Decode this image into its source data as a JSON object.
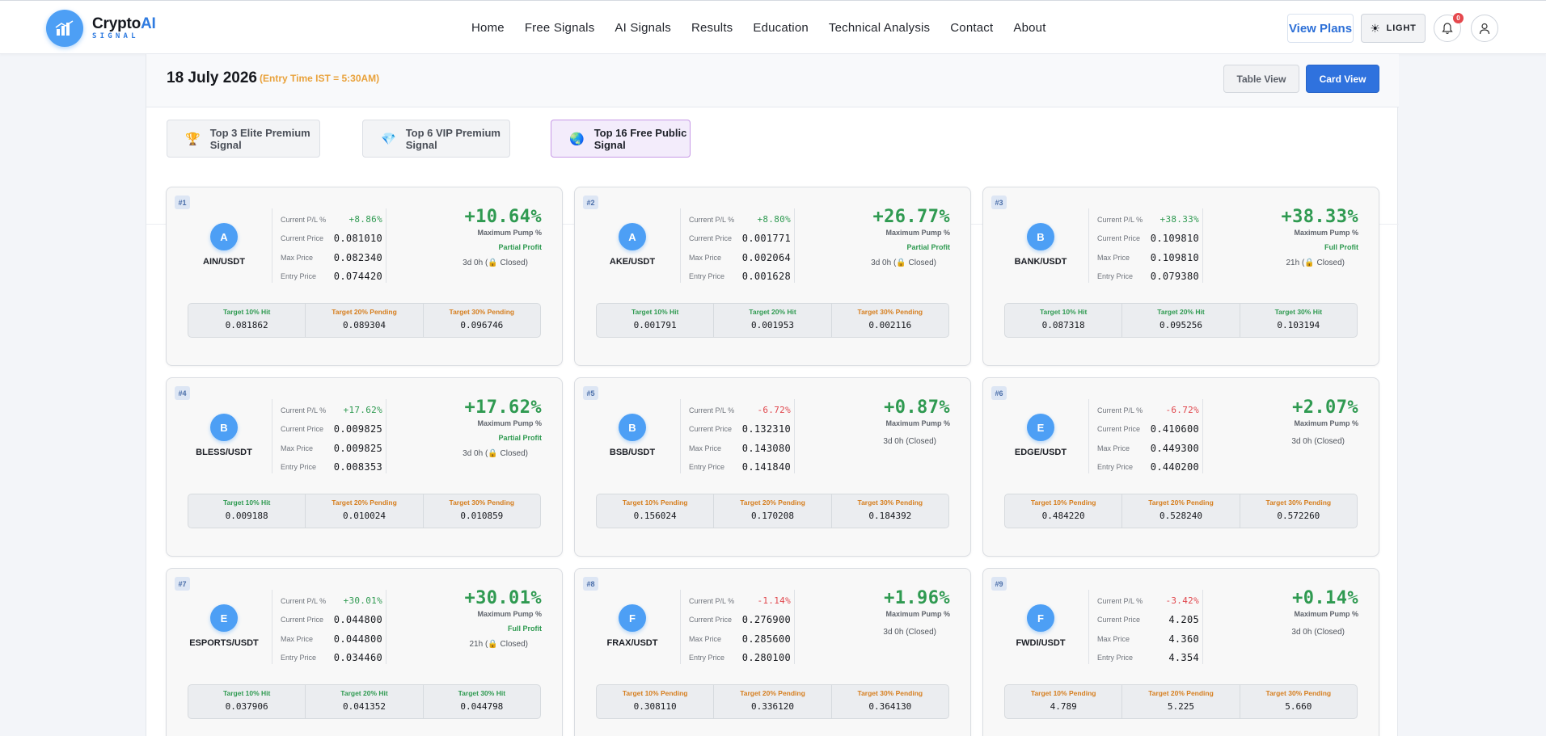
{
  "brand": {
    "name_main": "Crypto",
    "name_accent": "AI",
    "sub": "SIGNAL"
  },
  "nav": [
    "Home",
    "Free Signals",
    "AI Signals",
    "Results",
    "Education",
    "Technical Analysis",
    "Contact",
    "About"
  ],
  "header": {
    "view_plans": "View Plans",
    "theme_label": "LIGHT",
    "notification_count": "0"
  },
  "date_bar": {
    "date": "18 July 2026",
    "entry_time": "(Entry Time IST = 5:30AM)",
    "table_view": "Table View",
    "card_view": "Card View"
  },
  "tabs": [
    {
      "icon": "🏆",
      "label": "Top 3 Elite Premium Signal"
    },
    {
      "icon": "💎",
      "label": "Top 6 VIP Premium Signal"
    },
    {
      "icon": "🌏",
      "label": "Top 16 Free Public Signal"
    }
  ],
  "labels": {
    "pl": "Current P/L %",
    "current": "Current Price",
    "max": "Max Price",
    "entry": "Entry Price",
    "pump": "Maximum Pump %"
  },
  "colors": {
    "accent": "#2f72de",
    "positive": "#2f9a51",
    "negative": "#e0464c",
    "pending": "#d67e1e"
  },
  "cards": [
    {
      "num": "#1",
      "letter": "A",
      "pair": "AIN/USDT",
      "pl": "+8.86%",
      "pl_type": "pos",
      "current": "0.081010",
      "max": "0.082340",
      "entry": "0.074420",
      "pump": "+10.64%",
      "status": "Partial Profit",
      "time_prefix": "3d 0h (",
      "time_suffix": " Closed)",
      "lock": true,
      "targets": [
        {
          "label": "Target 10% Hit",
          "type": "hit",
          "value": "0.081862"
        },
        {
          "label": "Target 20% Pending",
          "type": "pending",
          "value": "0.089304"
        },
        {
          "label": "Target 30% Pending",
          "type": "pending",
          "value": "0.096746"
        }
      ]
    },
    {
      "num": "#2",
      "letter": "A",
      "pair": "AKE/USDT",
      "pl": "+8.80%",
      "pl_type": "pos",
      "current": "0.001771",
      "max": "0.002064",
      "entry": "0.001628",
      "pump": "+26.77%",
      "status": "Partial Profit",
      "time_prefix": "3d 0h (",
      "time_suffix": " Closed)",
      "lock": true,
      "targets": [
        {
          "label": "Target 10% Hit",
          "type": "hit",
          "value": "0.001791"
        },
        {
          "label": "Target 20% Hit",
          "type": "hit",
          "value": "0.001953"
        },
        {
          "label": "Target 30% Pending",
          "type": "pending",
          "value": "0.002116"
        }
      ]
    },
    {
      "num": "#3",
      "letter": "B",
      "pair": "BANK/USDT",
      "pl": "+38.33%",
      "pl_type": "pos",
      "current": "0.109810",
      "max": "0.109810",
      "entry": "0.079380",
      "pump": "+38.33%",
      "status": "Full Profit",
      "time_prefix": "21h (",
      "time_suffix": " Closed)",
      "lock": true,
      "targets": [
        {
          "label": "Target 10% Hit",
          "type": "hit",
          "value": "0.087318"
        },
        {
          "label": "Target 20% Hit",
          "type": "hit",
          "value": "0.095256"
        },
        {
          "label": "Target 30% Hit",
          "type": "hit",
          "value": "0.103194"
        }
      ]
    },
    {
      "num": "#4",
      "letter": "B",
      "pair": "BLESS/USDT",
      "pl": "+17.62%",
      "pl_type": "pos",
      "current": "0.009825",
      "max": "0.009825",
      "entry": "0.008353",
      "pump": "+17.62%",
      "status": "Partial Profit",
      "time_prefix": "3d 0h (",
      "time_suffix": " Closed)",
      "lock": true,
      "targets": [
        {
          "label": "Target 10% Hit",
          "type": "hit",
          "value": "0.009188"
        },
        {
          "label": "Target 20% Pending",
          "type": "pending",
          "value": "0.010024"
        },
        {
          "label": "Target 30% Pending",
          "type": "pending",
          "value": "0.010859"
        }
      ]
    },
    {
      "num": "#5",
      "letter": "B",
      "pair": "BSB/USDT",
      "pl": "-6.72%",
      "pl_type": "neg",
      "current": "0.132310",
      "max": "0.143080",
      "entry": "0.141840",
      "pump": "+0.87%",
      "status": "",
      "time_prefix": "3d 0h (Closed)",
      "time_suffix": "",
      "lock": false,
      "targets": [
        {
          "label": "Target 10% Pending",
          "type": "pending",
          "value": "0.156024"
        },
        {
          "label": "Target 20% Pending",
          "type": "pending",
          "value": "0.170208"
        },
        {
          "label": "Target 30% Pending",
          "type": "pending",
          "value": "0.184392"
        }
      ]
    },
    {
      "num": "#6",
      "letter": "E",
      "pair": "EDGE/USDT",
      "pl": "-6.72%",
      "pl_type": "neg",
      "current": "0.410600",
      "max": "0.449300",
      "entry": "0.440200",
      "pump": "+2.07%",
      "status": "",
      "time_prefix": "3d 0h (Closed)",
      "time_suffix": "",
      "lock": false,
      "targets": [
        {
          "label": "Target 10% Pending",
          "type": "pending",
          "value": "0.484220"
        },
        {
          "label": "Target 20% Pending",
          "type": "pending",
          "value": "0.528240"
        },
        {
          "label": "Target 30% Pending",
          "type": "pending",
          "value": "0.572260"
        }
      ]
    },
    {
      "num": "#7",
      "letter": "E",
      "pair": "ESPORTS/USDT",
      "pl": "+30.01%",
      "pl_type": "pos",
      "current": "0.044800",
      "max": "0.044800",
      "entry": "0.034460",
      "pump": "+30.01%",
      "status": "Full Profit",
      "time_prefix": "21h (",
      "time_suffix": " Closed)",
      "lock": true,
      "targets": [
        {
          "label": "Target 10% Hit",
          "type": "hit",
          "value": "0.037906"
        },
        {
          "label": "Target 20% Hit",
          "type": "hit",
          "value": "0.041352"
        },
        {
          "label": "Target 30% Hit",
          "type": "hit",
          "value": "0.044798"
        }
      ]
    },
    {
      "num": "#8",
      "letter": "F",
      "pair": "FRAX/USDT",
      "pl": "-1.14%",
      "pl_type": "neg",
      "current": "0.276900",
      "max": "0.285600",
      "entry": "0.280100",
      "pump": "+1.96%",
      "status": "",
      "time_prefix": "3d 0h (Closed)",
      "time_suffix": "",
      "lock": false,
      "targets": [
        {
          "label": "Target 10% Pending",
          "type": "pending",
          "value": "0.308110"
        },
        {
          "label": "Target 20% Pending",
          "type": "pending",
          "value": "0.336120"
        },
        {
          "label": "Target 30% Pending",
          "type": "pending",
          "value": "0.364130"
        }
      ]
    },
    {
      "num": "#9",
      "letter": "F",
      "pair": "FWDI/USDT",
      "pl": "-3.42%",
      "pl_type": "neg",
      "current": "4.205",
      "max": "4.360",
      "entry": "4.354",
      "pump": "+0.14%",
      "status": "",
      "time_prefix": "3d 0h (Closed)",
      "time_suffix": "",
      "lock": false,
      "targets": [
        {
          "label": "Target 10% Pending",
          "type": "pending",
          "value": "4.789"
        },
        {
          "label": "Target 20% Pending",
          "type": "pending",
          "value": "5.225"
        },
        {
          "label": "Target 30% Pending",
          "type": "pending",
          "value": "5.660"
        }
      ]
    }
  ]
}
